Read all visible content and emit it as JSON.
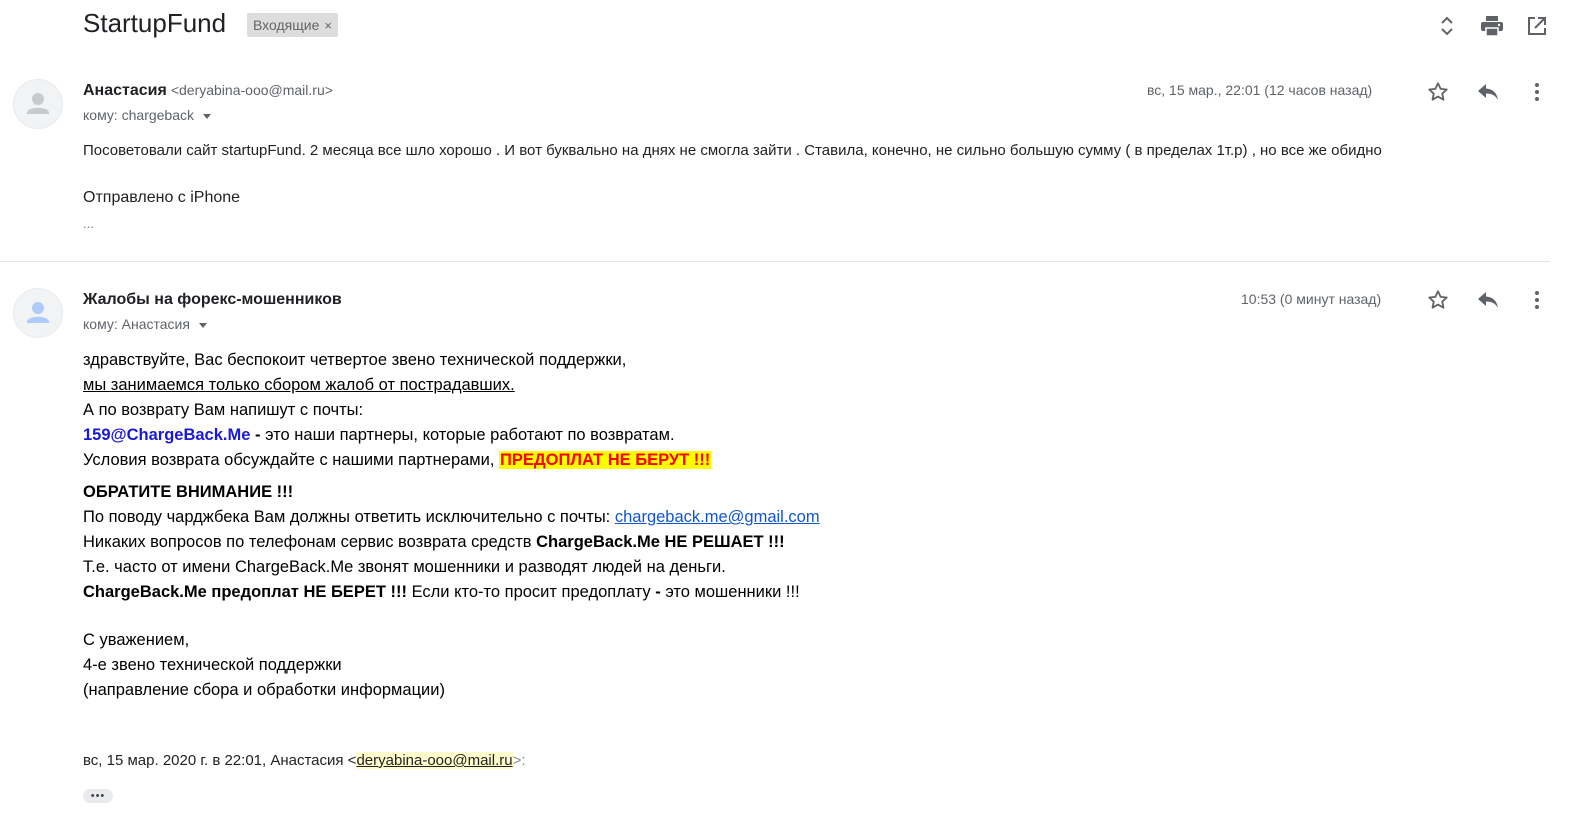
{
  "thread": {
    "subject": "StartupFund",
    "label": "Входящие",
    "label_remove": "×"
  },
  "icons": {
    "expand": "unfold-icon",
    "print": "print-icon",
    "open_new_window": "open-in-new-icon",
    "star": "star-icon",
    "reply": "reply-icon",
    "more": "more-vert-icon",
    "avatar": "person-icon"
  },
  "messages": [
    {
      "sender_name": "Анастасия",
      "sender_email": "<deryabina-ooo@mail.ru>",
      "to_line": "кому: chargeback",
      "date": "вс, 15 мар., 22:01 (12 часов назад)",
      "body_line1": "Посоветовали сайт startupFund. 2 месяца все шло хорошо . И вот буквально на днях не смогла зайти . Ставила, конечно, не сильно большую сумму ( в пределах 1т.р) , но все же обидно",
      "signature": "Отправлено с iPhone",
      "trimmed": "..."
    },
    {
      "sender_name": "Жалобы на форекс-мошенников",
      "to_line": "кому: Анастасия",
      "date": "10:53 (0 минут назад)",
      "lines": {
        "l1": "здравствуйте, Вас беспокоит четвертое звено технической поддержки,",
        "l2": "мы занимаемся только сбором жалоб от пострадавших.",
        "l3": "А по возврату Вам напишут с почты:",
        "l4_email": "159@ChargeBack.Me",
        "l4_dash": " - ",
        "l4_rest": "это наши партнеры, которые работают по возвратам.",
        "l5_text": "Условия возврата обсуждайте с нашими партнерами, ",
        "l5_highlight": "ПРЕДОПЛАТ НЕ БЕРУТ !!!",
        "l6": "ОБРАТИТЕ ВНИМАНИЕ !!!",
        "l7_text": "По поводу чарджбека Вам должны ответить исключительно с почты: ",
        "l7_link": "chargeback.me@gmail.com",
        "l8_text": "Никаких вопросов по телефонам сервис возврата средств ",
        "l8_bold": "ChargeBack.Me НЕ РЕШАЕТ !!!",
        "l9": "Т.е. часто от имени ChargeBack.Me звонят мошенники и разводят людей на деньги.",
        "l10_bold": "ChargeBack.Me предоплат НЕ БЕРЕТ !!!",
        "l10_text1": " Если кто-то просит предоплату ",
        "l10_dash": "-",
        "l10_text2": " это мошенники !!!",
        "l11": "С уважением,",
        "l12": "4-е звено технической поддержки",
        "l13": "(направление сбора и обработки информации)"
      },
      "quote_header_prefix": "вс, 15 мар. 2020 г. в 22:01, Анастасия <",
      "quote_header_email": "deryabina-ooo@mail.ru",
      "quote_header_suffix": ">:",
      "show_trimmed": "•••"
    }
  ]
}
